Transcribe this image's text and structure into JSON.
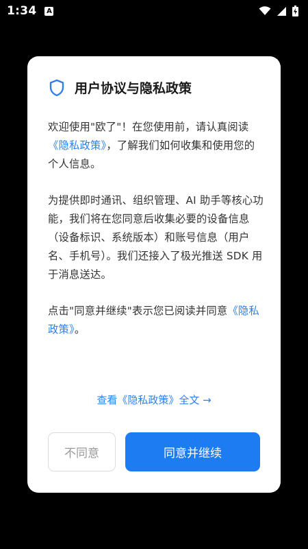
{
  "status_bar": {
    "time": "1:34",
    "notification_icon": "A"
  },
  "dialog": {
    "title": "用户协议与隐私政策",
    "icon": "shield-icon",
    "paragraph1": {
      "prefix": "欢迎使用\"欧了\"！在您使用前，请认真阅读",
      "link": "《隐私政策》",
      "suffix": "，了解我们如何收集和使用您的个人信息。"
    },
    "paragraph2": "为提供即时通讯、组织管理、AI 助手等核心功能，我们将在您同意后收集必要的设备信息（设备标识、系统版本）和账号信息（用户名、手机号）。我们还接入了极光推送 SDK 用于消息送达。",
    "paragraph3": {
      "prefix": "点击\"同意并继续\"表示您已阅读并同意",
      "link": "《隐私政策》",
      "suffix": "。"
    },
    "full_policy_link": "查看《隐私政策》全文 →",
    "disagree_button": "不同意",
    "agree_button": "同意并继续"
  },
  "colors": {
    "accent": "#1e7cf2",
    "link": "#2f80ed",
    "background": "#000000"
  }
}
